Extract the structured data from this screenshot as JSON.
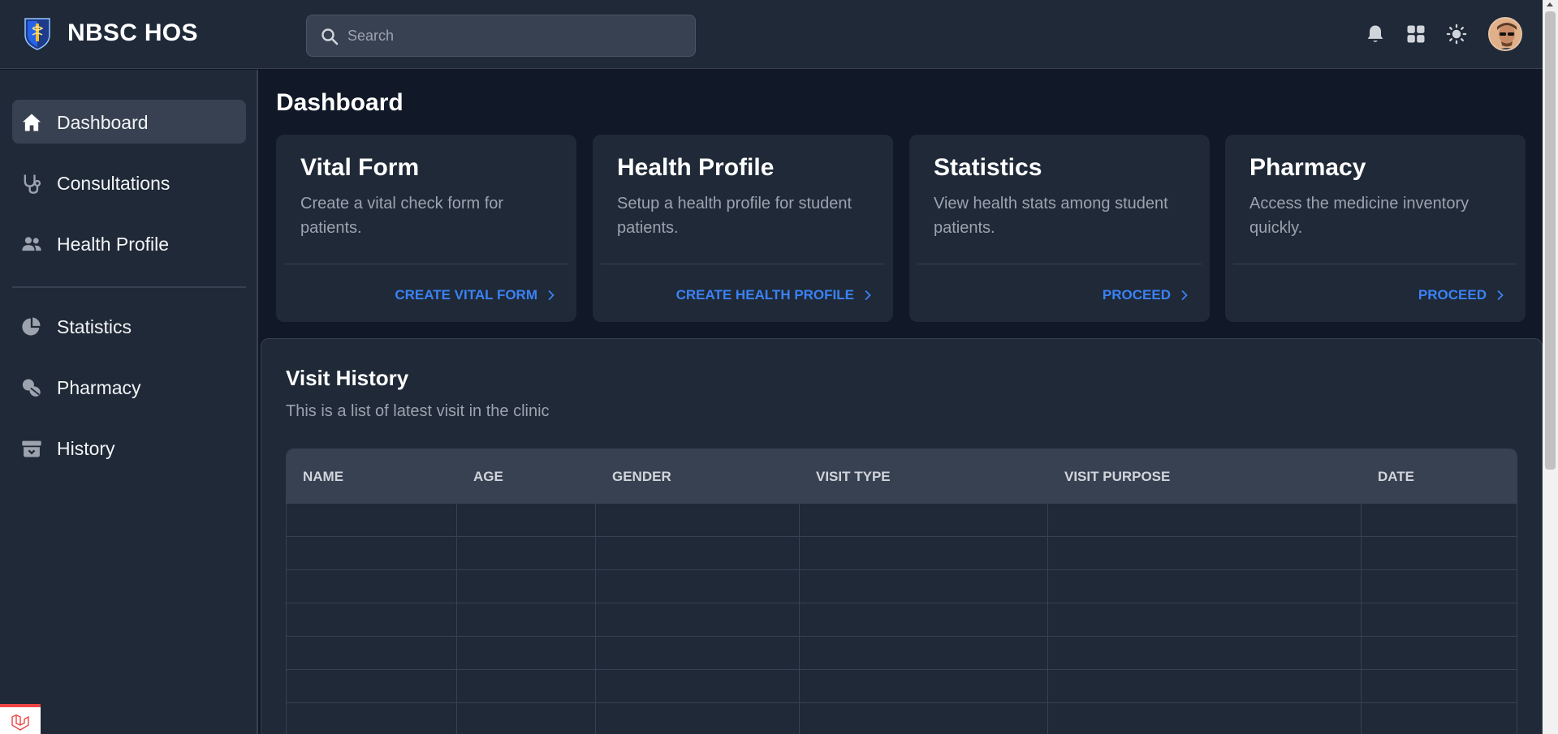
{
  "app": {
    "title": "NBSC HOS"
  },
  "search": {
    "placeholder": "Search"
  },
  "header_icons": [
    "bell-icon",
    "apps-grid-icon",
    "theme-sun-icon",
    "user-avatar"
  ],
  "sidebar": {
    "items": [
      {
        "label": "Dashboard",
        "icon": "home-icon",
        "active": true
      },
      {
        "label": "Consultations",
        "icon": "stethoscope-icon"
      },
      {
        "label": "Health Profile",
        "icon": "users-icon"
      },
      {
        "label": "Statistics",
        "icon": "pie-chart-icon"
      },
      {
        "label": "Pharmacy",
        "icon": "pills-icon"
      },
      {
        "label": "History",
        "icon": "archive-icon"
      }
    ]
  },
  "page": {
    "title": "Dashboard"
  },
  "cards": [
    {
      "title": "Vital Form",
      "description": "Create a vital check form for patients.",
      "link": "CREATE VITAL FORM"
    },
    {
      "title": "Health Profile",
      "description": "Setup a health profile for student patients.",
      "link": "CREATE HEALTH PROFILE"
    },
    {
      "title": "Statistics",
      "description": "View health stats among student patients.",
      "link": "PROCEED"
    },
    {
      "title": "Pharmacy",
      "description": "Access the medicine inventory quickly.",
      "link": "PROCEED"
    }
  ],
  "visit_history": {
    "title": "Visit History",
    "subtitle": "This is a list of latest visit in the clinic",
    "columns": [
      "NAME",
      "AGE",
      "GENDER",
      "VISIT TYPE",
      "VISIT PURPOSE",
      "DATE"
    ],
    "rows": []
  },
  "colors": {
    "accent": "#3b82f6",
    "surface": "#1f2937",
    "background": "#111827",
    "border": "#374151"
  }
}
